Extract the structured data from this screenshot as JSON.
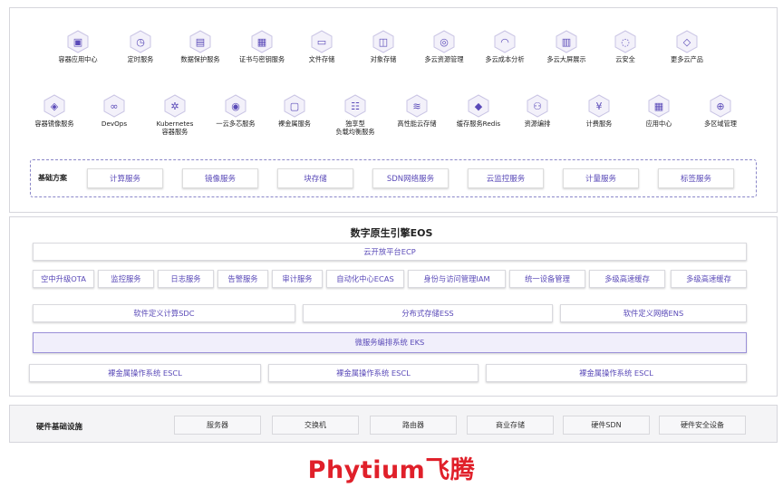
{
  "services_row1": [
    {
      "label": "容器应用中心",
      "icon": "container-app-icon"
    },
    {
      "label": "定时服务",
      "icon": "scheduler-icon"
    },
    {
      "label": "数据保护服务",
      "icon": "data-protect-icon"
    },
    {
      "label": "证书与密钥服务",
      "icon": "certificate-icon"
    },
    {
      "label": "文件存储",
      "icon": "file-storage-icon"
    },
    {
      "label": "对象存储",
      "icon": "object-storage-icon"
    },
    {
      "label": "多云资源管理",
      "icon": "multicloud-resource-icon"
    },
    {
      "label": "多云成本分析",
      "icon": "cost-analysis-icon"
    },
    {
      "label": "多云大屏展示",
      "icon": "dashboard-icon"
    },
    {
      "label": "云安全",
      "icon": "cloud-security-icon"
    },
    {
      "label": "更多云产品",
      "icon": "cube-icon"
    }
  ],
  "services_row2": [
    {
      "label": "容器镜像服务",
      "icon": "container-image-icon"
    },
    {
      "label": "DevOps",
      "icon": "devops-icon"
    },
    {
      "label": "Kubernetes\n容器服务",
      "icon": "kubernetes-icon"
    },
    {
      "label": "一云多芯服务",
      "icon": "multichip-icon"
    },
    {
      "label": "裸金属服务",
      "icon": "bare-metal-icon"
    },
    {
      "label": "独享型\n负载均衡服务",
      "icon": "load-balancer-icon"
    },
    {
      "label": "高性能云存储",
      "icon": "hp-storage-icon"
    },
    {
      "label": "缓存服务Redis",
      "icon": "redis-icon"
    },
    {
      "label": "资源编排",
      "icon": "orchestration-icon"
    },
    {
      "label": "计费服务",
      "icon": "billing-icon"
    },
    {
      "label": "应用中心",
      "icon": "app-center-icon"
    },
    {
      "label": "多区域管理",
      "icon": "multi-region-icon"
    }
  ],
  "basic": {
    "title": "基础方案",
    "items": [
      "计算服务",
      "镜像服务",
      "块存储",
      "SDN网络服务",
      "云监控服务",
      "计量服务",
      "标签服务"
    ]
  },
  "eos": {
    "title": "数字原生引擎EOS",
    "ecp": "云开放平台ECP",
    "row1": [
      "空中升级OTA",
      "监控服务",
      "日志服务",
      "告警服务",
      "审计服务",
      "自动化中心ECAS",
      "身份与访问管理IAM",
      "统一设备管理",
      "多级高速缓存",
      "多级高速缓存"
    ],
    "row2": [
      "软件定义计算SDC",
      "分布式存储ESS",
      "软件定义网络ENS"
    ],
    "eks": "微服务编排系统 EKS",
    "row3": [
      "裸金属操作系统 ESCL",
      "裸金属操作系统 ESCL",
      "裸金属操作系统 ESCL"
    ]
  },
  "hardware": {
    "title": "硬件基础设施",
    "items": [
      "服务器",
      "交换机",
      "路由器",
      "商业存储",
      "硬件SDN",
      "硬件安全设备"
    ]
  },
  "logo": {
    "text": "Phytium飞腾",
    "color": "#e0202a"
  },
  "colors": {
    "accent": "#5a4ab8",
    "hex_fill": "#f3f1fa",
    "hex_stroke": "#c9c4e4"
  }
}
